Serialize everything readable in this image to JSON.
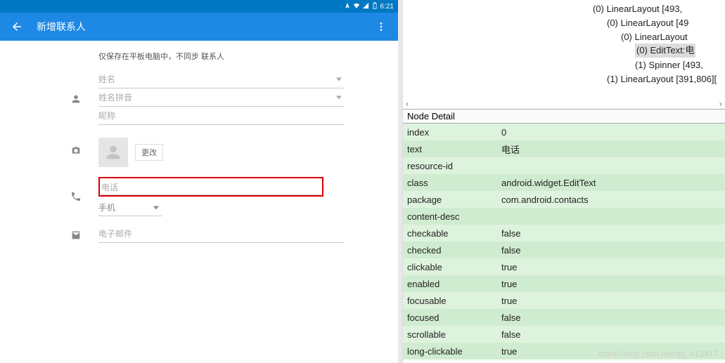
{
  "statusbar": {
    "time": "6:21"
  },
  "appbar": {
    "title": "新增联系人"
  },
  "form": {
    "note": "仅保存在平板电脑中，不同步 联系人",
    "name_ph": "姓名",
    "pinyin_ph": "姓名拼音",
    "nickname_ph": "昵称",
    "change_btn": "更改",
    "phone_ph": "电话",
    "phone_type": "手机",
    "email_ph": "电子邮件"
  },
  "tree": {
    "items": [
      {
        "indent": 250,
        "text": "(0) LinearLayout [493,"
      },
      {
        "indent": 270,
        "text": "(0) LinearLayout [49"
      },
      {
        "indent": 290,
        "text": "(0) LinearLayout "
      },
      {
        "indent": 310,
        "text": "(0) EditText:电",
        "selected": true
      },
      {
        "indent": 310,
        "text": "(1) Spinner [493,"
      },
      {
        "indent": 270,
        "text": "(1) LinearLayout [391,806]["
      }
    ]
  },
  "nodeDetail": {
    "header": "Node Detail",
    "props": [
      {
        "k": "index",
        "v": "0"
      },
      {
        "k": "text",
        "v": "电话"
      },
      {
        "k": "resource-id",
        "v": ""
      },
      {
        "k": "class",
        "v": "android.widget.EditText"
      },
      {
        "k": "package",
        "v": "com.android.contacts"
      },
      {
        "k": "content-desc",
        "v": ""
      },
      {
        "k": "checkable",
        "v": "false"
      },
      {
        "k": "checked",
        "v": "false"
      },
      {
        "k": "clickable",
        "v": "true"
      },
      {
        "k": "enabled",
        "v": "true"
      },
      {
        "k": "focusable",
        "v": "true"
      },
      {
        "k": "focused",
        "v": "false"
      },
      {
        "k": "scrollable",
        "v": "false"
      },
      {
        "k": "long-clickable",
        "v": "true"
      }
    ]
  },
  "watermark": "https://blog.csdn.net/qq_413417"
}
